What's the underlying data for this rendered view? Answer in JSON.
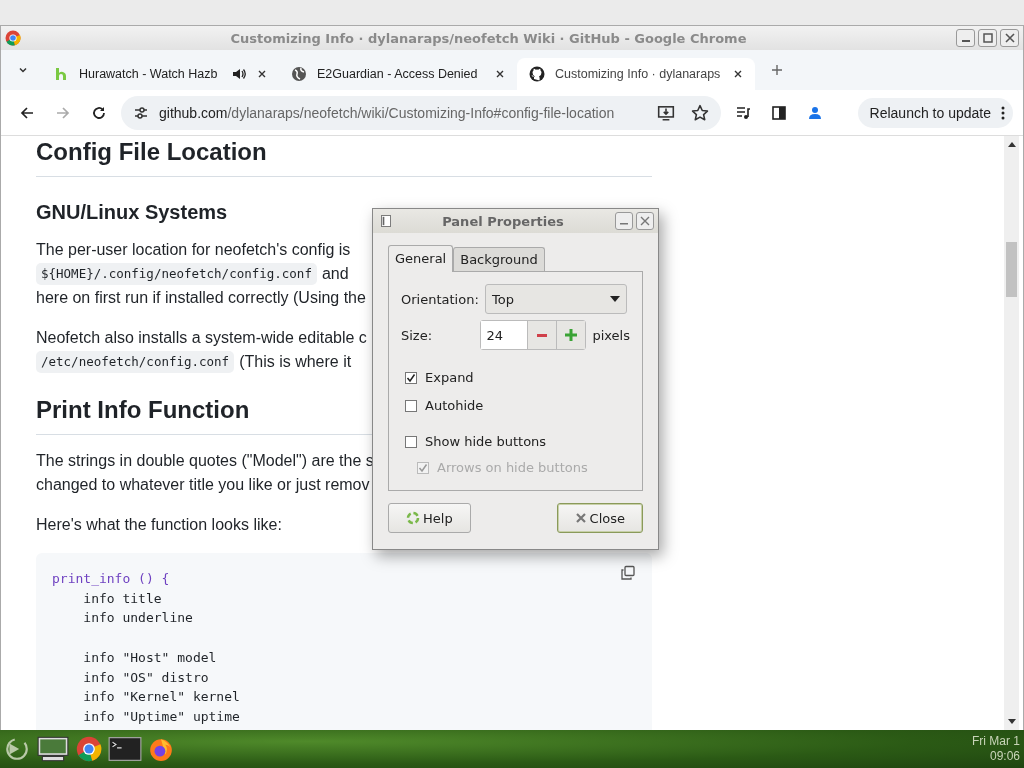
{
  "window": {
    "title": "Customizing Info · dylanaraps/neofetch Wiki · GitHub - Google Chrome"
  },
  "tabs": [
    {
      "title": "Hurawatch - Watch Hazb",
      "selected": false,
      "audio": true,
      "kind": "hura"
    },
    {
      "title": "E2Guardian - Access Denied",
      "selected": false,
      "audio": false,
      "kind": "globe"
    },
    {
      "title": "Customizing Info · dylanaraps",
      "selected": true,
      "audio": false,
      "kind": "github"
    }
  ],
  "address_bar": {
    "host": "github.com",
    "path": "/dylanaraps/neofetch/wiki/Customizing-Info#config-file-location"
  },
  "relaunch_button": "Relaunch to update",
  "article": [
    {
      "kind": "h2",
      "text": "Config File Location"
    },
    {
      "kind": "h3",
      "text": "GNU/Linux Systems"
    },
    {
      "kind": "p",
      "lines": [
        [
          {
            "text": "The per-user location for neofetch's config is",
            "code": false
          }
        ],
        [
          {
            "text": "${HOME}/.config/neofetch/config.conf",
            "code": true
          },
          {
            "text": "and",
            "code": false
          }
        ],
        [
          {
            "text": "here on first run if installed correctly (Using the",
            "code": false
          }
        ]
      ]
    },
    {
      "kind": "p",
      "lines": [
        [
          {
            "text": "Neofetch also installs a system-wide editable c",
            "code": false
          }
        ],
        [
          {
            "text": "/etc/neofetch/config.conf",
            "code": true
          },
          {
            "text": "(This is where it",
            "code": false
          }
        ]
      ]
    },
    {
      "kind": "h2",
      "text": "Print Info Function"
    },
    {
      "kind": "p",
      "lines": [
        [
          {
            "text": "The strings in double quotes (\"Model\") are the s",
            "code": false
          }
        ],
        [
          {
            "text": "changed to whatever title you like or just remov",
            "code": false
          }
        ]
      ]
    },
    {
      "kind": "p",
      "lines": [
        [
          {
            "text": "Here's what the function looks like:",
            "code": false
          }
        ]
      ]
    },
    {
      "kind": "code",
      "groups": [
        [
          "print_info () {",
          "    info title",
          "    info underline"
        ],
        [
          "    info \"Host\" model",
          "    info \"OS\" distro",
          "    info \"Kernel\" kernel",
          "    info \"Uptime\" uptime"
        ]
      ]
    }
  ],
  "dialog": {
    "title": "Panel Properties",
    "tabs": [
      {
        "label": "General",
        "selected": true
      },
      {
        "label": "Background",
        "selected": false
      }
    ],
    "orientation_label": "Orientation:",
    "orientation_value": "Top",
    "size_label": "Size:",
    "size_value": "24",
    "size_unit": "pixels",
    "options": [
      {
        "label": "Expand",
        "checked": true,
        "disabled": false
      },
      {
        "label": "Autohide",
        "checked": false,
        "disabled": false
      },
      {
        "label": "Show hide buttons",
        "checked": false,
        "disabled": false,
        "children": [
          {
            "label": "Arrows on hide buttons",
            "checked": true,
            "disabled": true
          }
        ]
      }
    ],
    "help_button": "Help",
    "close_button": "Close"
  },
  "taskbar": {
    "clock_date": "Fri Mar 1",
    "clock_time": "09:06"
  }
}
